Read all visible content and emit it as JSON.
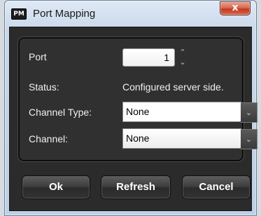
{
  "window": {
    "title": "Port Mapping",
    "icon_text": "PM",
    "icon": "app-icon",
    "close_glyph": "x"
  },
  "form": {
    "port": {
      "label": "Port",
      "value": "1"
    },
    "status": {
      "label": "Status:",
      "value": "Configured server side."
    },
    "channel_type": {
      "label": "Channel Type:",
      "value": "None"
    },
    "channel": {
      "label": "Channel:",
      "value": "None"
    }
  },
  "buttons": {
    "ok": "Ok",
    "refresh": "Refresh",
    "cancel": "Cancel"
  },
  "colors": {
    "dialog_bg": "#2b2b2b",
    "panel_border": "#0c0c0c",
    "close_button": "#c33a1f"
  }
}
